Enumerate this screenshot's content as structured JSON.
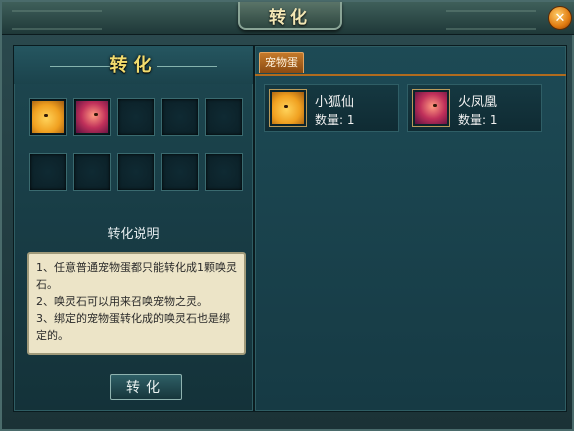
{
  "window": {
    "title": "转化",
    "close_icon": "close-icon"
  },
  "left_panel": {
    "title": "转化",
    "slots": [
      {
        "pet": "fox"
      },
      {
        "pet": "phoenix"
      },
      {
        "pet": null
      },
      {
        "pet": null
      },
      {
        "pet": null
      },
      {
        "pet": null
      },
      {
        "pet": null
      },
      {
        "pet": null
      },
      {
        "pet": null
      },
      {
        "pet": null
      }
    ],
    "description_title": "转化说明",
    "description_lines": [
      "1、任意普通宠物蛋都只能转化成1颗唤灵石。",
      "2、唤灵石可以用来召唤宠物之灵。",
      "3、绑定的宠物蛋转化成的唤灵石也是绑定的。"
    ],
    "convert_button": "转化"
  },
  "right_panel": {
    "tab_label": "宠物蛋",
    "pets": [
      {
        "name": "小狐仙",
        "count_label": "数量:",
        "count": "1",
        "icon": "fox-pet-icon"
      },
      {
        "name": "火凤凰",
        "count_label": "数量:",
        "count": "1",
        "icon": "phoenix-pet-icon"
      }
    ]
  },
  "colors": {
    "accent_gold": "#f3dc6e",
    "tab_orange": "#c47a2a"
  }
}
